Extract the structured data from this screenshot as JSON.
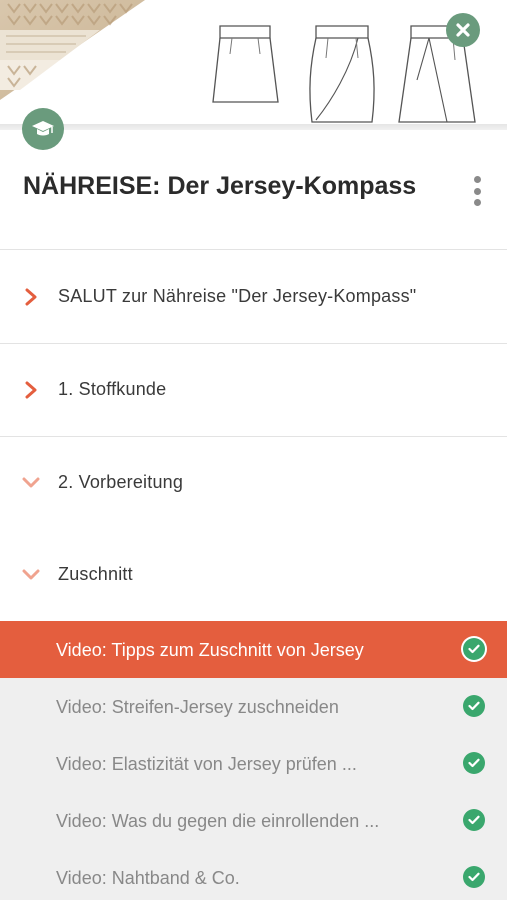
{
  "header": {
    "photo_icon": "knit-sweater-photo",
    "sketches": [
      "skirt-sketch-1",
      "skirt-sketch-2",
      "skirt-sketch-3"
    ],
    "close_icon": "close-icon",
    "badge_icon": "graduation-cap-icon"
  },
  "course": {
    "title": "NÄHREISE: Der Jersey-Kompass",
    "menu_icon": "more-vertical-icon"
  },
  "sections": [
    {
      "label": "SALUT zur Nähreise \"Der Jersey-Kompass\"",
      "state": "collapsed"
    },
    {
      "label": "1. Stoffkunde",
      "state": "collapsed"
    },
    {
      "label": "2. Vorbereitung",
      "state": "expanded"
    },
    {
      "label": "Zuschnitt",
      "state": "expanded"
    }
  ],
  "lessons": [
    {
      "label": "Video: Tipps zum Zuschnitt von Jersey",
      "active": true,
      "completed": true
    },
    {
      "label": "Video: Streifen-Jersey zuschneiden",
      "active": false,
      "completed": true
    },
    {
      "label": "Video: Elastizität von Jersey prüfen ...",
      "active": false,
      "completed": true
    },
    {
      "label": "Video: Was du gegen die einrollenden ...",
      "active": false,
      "completed": true
    },
    {
      "label": "Video: Nahtband & Co.",
      "active": false,
      "completed": true
    }
  ],
  "colors": {
    "accent": "#e45e3e",
    "brand_green": "#6a9b7d",
    "check_green": "#3aa76d",
    "lesson_bg": "#efefef"
  }
}
